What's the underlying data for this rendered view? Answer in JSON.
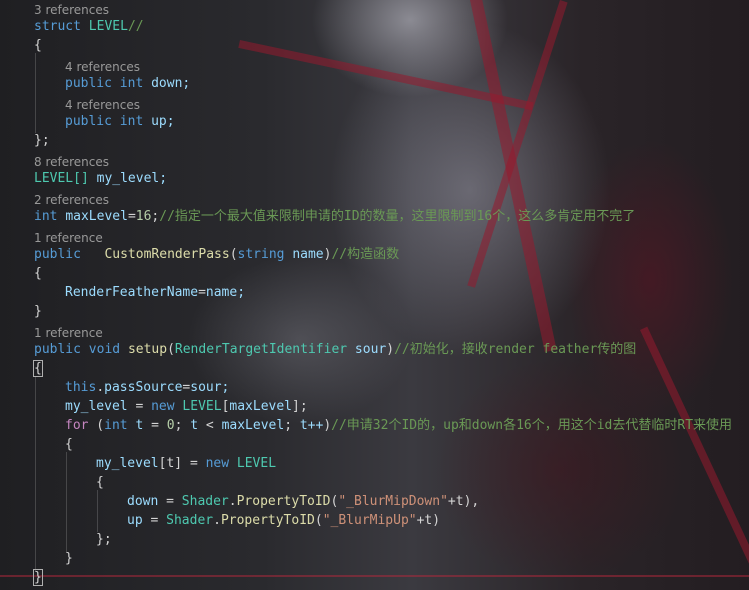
{
  "editor": {
    "theme_colors": {
      "keyword": "#569cd6",
      "control_keyword": "#c586c0",
      "type": "#4ec9b0",
      "function": "#dcdcaa",
      "variable": "#9cdcfe",
      "number": "#b5cea8",
      "string": "#ce9178",
      "comment": "#6a9955",
      "codelens": "#999999",
      "text": "#d4d4d4"
    },
    "codelens": {
      "struct_refs": "3 references",
      "down_refs": "4 references",
      "up_refs": "4 references",
      "my_level_refs": "8 references",
      "maxlevel_refs": "2 references",
      "ctor_refs": "1 reference",
      "setup_refs": "1 reference"
    },
    "tokens": {
      "struct": "struct",
      "level": "LEVEL",
      "comment_slashes": "//",
      "open_brace": "{",
      "close_brace": "}",
      "close_brace_semi": "};",
      "public": "public",
      "int": "int",
      "down_decl": "down;",
      "up_decl": "up;",
      "level_arr": "LEVEL[]",
      "my_level_decl": "my_level;",
      "maxlevel_name": "maxLevel",
      "eq": "=",
      "sixteen": "16",
      "semi": ";",
      "maxlevel_comment": "//指定一个最大值来限制申请的ID的数量，这里限制到16个，这么多肯定用不完了",
      "ctor_name": "CustomRenderPass",
      "open_paren": "(",
      "string": "string",
      "name_param": "name",
      "close_paren": ")",
      "ctor_comment": "//构造函数",
      "render_feather_name": "RenderFeatherName",
      "name_semi": "name;",
      "void": "void",
      "setup": "setup",
      "rti": "RenderTargetIdentifier",
      "sour": "sour",
      "setup_comment": "//初始化，接收render feather传的图",
      "this": "this",
      "dot": ".",
      "pass_source": "passSource",
      "sour_semi": "sour;",
      "my_level": "my_level",
      "new": "new",
      "open_bracket": "[",
      "close_bracket_semi": "];",
      "for": "for",
      "for_open": " (",
      "t": "t",
      "zero": "0",
      "lt": "<",
      "t_inc": "t++",
      "for_comment": "//申请32个ID的，up和down各16个，用这个id去代替临时RT来使用",
      "index_t": "[t]",
      "down": "down",
      "up": "up",
      "shader": "Shader",
      "property_to_id": "PropertyToID",
      "blur_down": "\"_BlurMipDown\"",
      "blur_up": "\"_BlurMipUp\"",
      "plus_t_comma": "+t),",
      "plus_t": "+t)"
    }
  }
}
